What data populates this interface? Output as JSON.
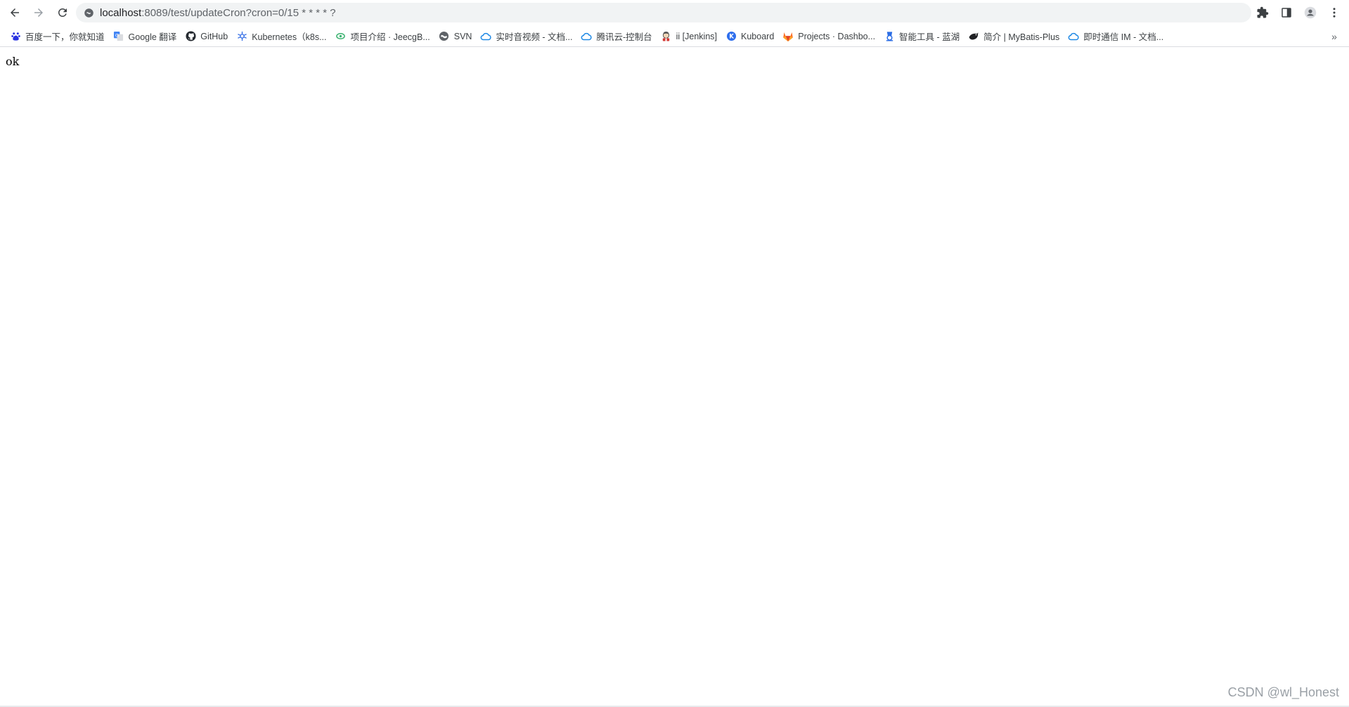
{
  "browser": {
    "url_host": "localhost",
    "url_rest": ":8089/test/updateCron?cron=0/15 * * * * ?",
    "icons": {
      "back": "arrow-left-icon",
      "forward": "arrow-right-icon",
      "reload": "reload-icon",
      "site": "site-info-icon",
      "extensions": "puzzle-icon",
      "side_panel": "side-panel-icon",
      "profile": "profile-icon",
      "menu": "kebab-menu-icon"
    }
  },
  "bookmarks": [
    {
      "label": "百度一下，你就知道",
      "icon": "baidu-paw-icon",
      "color": "#2932e1"
    },
    {
      "label": "Google 翻译",
      "icon": "translate-icon",
      "color": "#4285f4"
    },
    {
      "label": "GitHub",
      "icon": "github-icon",
      "color": "#24292f"
    },
    {
      "label": "Kubernetes（k8s...",
      "icon": "kubernetes-icon",
      "color": "#326ce5"
    },
    {
      "label": "项目介绍 · JeecgB...",
      "icon": "jeecg-icon",
      "color": "#3cb371"
    },
    {
      "label": "SVN",
      "icon": "globe-icon",
      "color": "#5f6368"
    },
    {
      "label": "实时音视频 - 文档...",
      "icon": "cloud-icon",
      "color": "#1e88e5"
    },
    {
      "label": "腾讯云-控制台",
      "icon": "cloud-icon",
      "color": "#1e88e5"
    },
    {
      "label": "ii [Jenkins]",
      "icon": "jenkins-icon",
      "color": "#d33833"
    },
    {
      "label": "Kuboard",
      "icon": "kuboard-icon",
      "color": "#2f6fed"
    },
    {
      "label": "Projects · Dashbo...",
      "icon": "gitlab-icon",
      "color": "#fc6d26"
    },
    {
      "label": "智能工具 - 蓝湖",
      "icon": "lanhu-icon",
      "color": "#2b6de5"
    },
    {
      "label": "简介 | MyBatis-Plus",
      "icon": "mybatis-bird-icon",
      "color": "#202124"
    },
    {
      "label": "即时通信 IM - 文档...",
      "icon": "cloud-icon",
      "color": "#1e88e5"
    }
  ],
  "page": {
    "body_text": "ok"
  },
  "watermark": "CSDN @wl_Honest"
}
